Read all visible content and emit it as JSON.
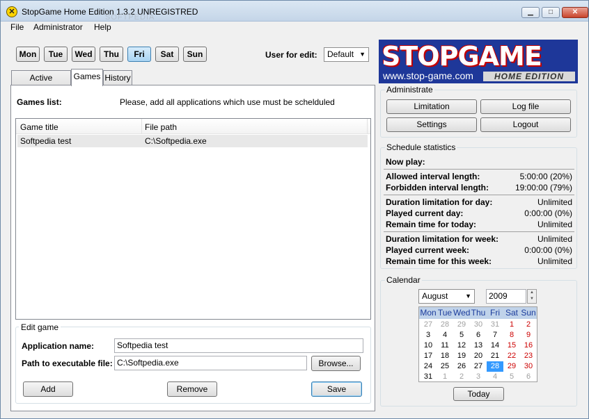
{
  "window": {
    "title": "StopGame Home Edition 1.3.2 UNREGISTRED",
    "watermark": "SOFTPEDIA",
    "watermark_url": "www.softpedia.com"
  },
  "menu": [
    "File",
    "Administrator",
    "Help"
  ],
  "days": [
    "Mon",
    "Tue",
    "Wed",
    "Thu",
    "Fri",
    "Sat",
    "Sun"
  ],
  "selected_day": "Fri",
  "user_for_edit": {
    "label": "User for edit:",
    "value": "Default"
  },
  "tabs": [
    "Active schedule",
    "Games",
    "History"
  ],
  "active_tab": "Games",
  "games": {
    "list_label": "Games list:",
    "hint": "Please, add all applications which use must be schelduled",
    "columns": [
      "Game title",
      "File path"
    ],
    "rows": [
      {
        "title": "Softpedia test",
        "path": "C:\\Softpedia.exe"
      }
    ]
  },
  "edit_game": {
    "group_title": "Edit game",
    "app_name_label": "Application name:",
    "app_name_value": "Softpedia test",
    "path_label": "Path to executable file:",
    "path_value": "C:\\Softpedia.exe",
    "browse": "Browse...",
    "add": "Add",
    "remove": "Remove",
    "save": "Save"
  },
  "logo": {
    "brand": "STOPGAME",
    "url": "www.stop-game.com",
    "edition": "HOME EDITION"
  },
  "administrate": {
    "title": "Administrate",
    "limitation": "Limitation",
    "log_file": "Log file",
    "settings": "Settings",
    "logout": "Logout"
  },
  "stats": {
    "title": "Schedule statistics",
    "now_play": "Now play:",
    "rows": [
      {
        "k": "Allowed interval length:",
        "v": "5:00:00 (20%)"
      },
      {
        "k": "Forbidden interval length:",
        "v": "19:00:00 (79%)"
      },
      {
        "k": "Duration limitation for day:",
        "v": "Unlimited"
      },
      {
        "k": "Played current day:",
        "v": "0:00:00 (0%)"
      },
      {
        "k": "Remain time for today:",
        "v": "Unlimited"
      },
      {
        "k": "Duration limitation for week:",
        "v": "Unlimited"
      },
      {
        "k": "Played current week:",
        "v": "0:00:00 (0%)"
      },
      {
        "k": "Remain time for this week:",
        "v": "Unlimited"
      }
    ]
  },
  "calendar": {
    "title": "Calendar",
    "month": "August",
    "year": "2009",
    "weekdays": [
      "Mon",
      "Tue",
      "Wed",
      "Thu",
      "Fri",
      "Sat",
      "Sun"
    ],
    "weeks": [
      [
        "27",
        "28",
        "29",
        "30",
        "31",
        "1",
        "2"
      ],
      [
        "3",
        "4",
        "5",
        "6",
        "7",
        "8",
        "9"
      ],
      [
        "10",
        "11",
        "12",
        "13",
        "14",
        "15",
        "16"
      ],
      [
        "17",
        "18",
        "19",
        "20",
        "21",
        "22",
        "23"
      ],
      [
        "24",
        "25",
        "26",
        "27",
        "28",
        "29",
        "30"
      ],
      [
        "31",
        "1",
        "2",
        "3",
        "4",
        "5",
        "6"
      ]
    ],
    "selected": "28",
    "today_button": "Today",
    "colors": {
      "weekend": "#cc0000",
      "other_month": "#a0a0a0",
      "selected_bg": "#3399ff"
    }
  }
}
